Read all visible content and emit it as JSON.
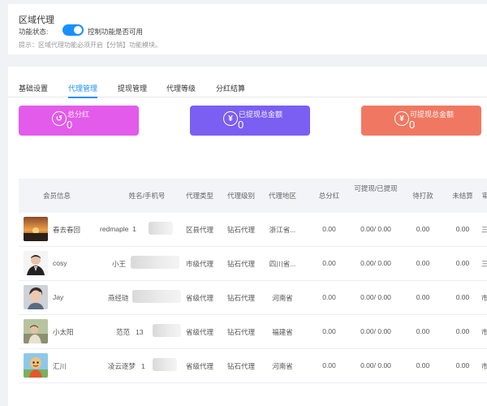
{
  "top": {
    "title": "区域代理",
    "status_label": "功能状态:",
    "status_on": true,
    "status_desc": "控制功能是否可用",
    "hint": "提示：区域代理功能必须开启【分销】功能模块。"
  },
  "tabs": [
    {
      "label": "基础设置",
      "active": false
    },
    {
      "label": "代理管理",
      "active": true
    },
    {
      "label": "提现管理",
      "active": false
    },
    {
      "label": "代理等级",
      "active": false
    },
    {
      "label": "分红结算",
      "active": false
    }
  ],
  "stats": [
    {
      "label": "总分红",
      "value": "0",
      "color": "#e35bea",
      "icon": "dividend-icon",
      "glyph": "↺"
    },
    {
      "label": "已提现总金额",
      "value": "0",
      "color": "#7b5ef2",
      "icon": "yen-coin-icon",
      "glyph": "¥"
    },
    {
      "label": "可提现总金额",
      "value": "0",
      "color": "#f07862",
      "icon": "yen-coin-icon",
      "glyph": "¥"
    }
  ],
  "table": {
    "headers": [
      "会员信息",
      "姓名/手机号",
      "代理类型",
      "代理级别",
      "代理地区",
      "总分红",
      "可提现/已提现",
      "待打款",
      "未结算",
      "审"
    ],
    "rows": [
      {
        "member": "春去春回",
        "name": "redmaple",
        "phone_prefix": "1",
        "type": "区县代理",
        "level": "钻石代理",
        "region": "浙江省...",
        "total": "0.00",
        "withdraw": "0.00/ 0.00",
        "pending": "0.00",
        "unsettled": "0.00",
        "cut": "三",
        "avatar": "sunset"
      },
      {
        "member": "cosy",
        "name": "小王",
        "phone_prefix": "",
        "type": "市级代理",
        "level": "钻石代理",
        "region": "四川省...",
        "total": "0.00",
        "withdraw": "0.00/ 0.00",
        "pending": "0.00",
        "unsettled": "0.00",
        "cut": "三",
        "avatar": "suit"
      },
      {
        "member": "Jay",
        "name": "燕经琏",
        "phone_prefix": "",
        "type": "省级代理",
        "level": "钻石代理",
        "region": "河南省",
        "total": "0.00",
        "withdraw": "0.00/ 0.00",
        "pending": "0.00",
        "unsettled": "0.00",
        "cut": "市",
        "avatar": "portrait"
      },
      {
        "member": "小太阳",
        "name": "范范",
        "phone_prefix": "13",
        "type": "省级代理",
        "level": "钻石代理",
        "region": "福建省",
        "total": "0.00",
        "withdraw": "0.00/ 0.00",
        "pending": "0.00",
        "unsettled": "0.00",
        "cut": "市",
        "avatar": "kid"
      },
      {
        "member": "汇川",
        "name": "凌云逐梦",
        "phone_prefix": "1",
        "type": "省级代理",
        "level": "钻石代理",
        "region": "河南省",
        "total": "0.00",
        "withdraw": "0.00/ 0.00",
        "pending": "0.00",
        "unsettled": "0.00",
        "cut": "市",
        "avatar": "cartoon"
      }
    ]
  }
}
